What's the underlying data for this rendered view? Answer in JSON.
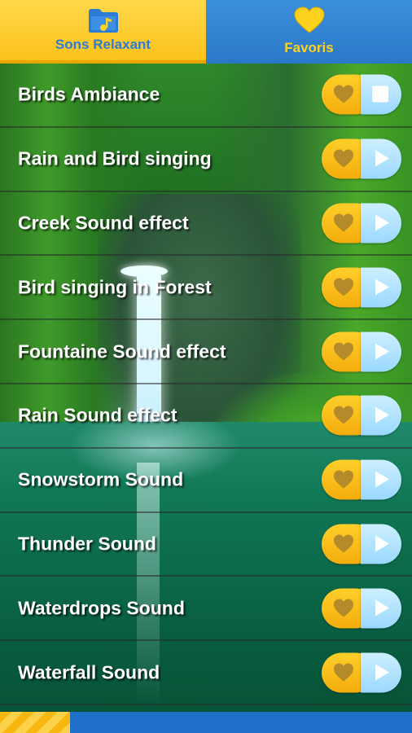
{
  "tabs": [
    {
      "label": "Sons Relaxant",
      "icon": "folder-music-icon",
      "active": true
    },
    {
      "label": "Favoris",
      "icon": "heart-icon",
      "active": false
    }
  ],
  "sounds": [
    {
      "title": "Birds Ambiance",
      "state": "playing"
    },
    {
      "title": "Rain and Bird singing",
      "state": "stopped"
    },
    {
      "title": "Creek Sound effect",
      "state": "stopped"
    },
    {
      "title": "Bird singing in Forest",
      "state": "stopped"
    },
    {
      "title": "Fountaine Sound effect",
      "state": "stopped"
    },
    {
      "title": "Rain Sound effect",
      "state": "stopped"
    },
    {
      "title": "Snowstorm Sound",
      "state": "stopped"
    },
    {
      "title": "Thunder Sound",
      "state": "stopped"
    },
    {
      "title": "Waterdrops Sound",
      "state": "stopped"
    },
    {
      "title": "Waterfall Sound",
      "state": "stopped"
    }
  ],
  "playback_progress": 0.17,
  "colors": {
    "tab_active_bg": "#fcc21b",
    "tab_inactive_bg": "#2a78c8",
    "favorite_button": "#f4ad0c",
    "play_button": "#9ad8ff",
    "heart_fill": "#b48a2a",
    "footer_bg": "#1f70c8"
  }
}
